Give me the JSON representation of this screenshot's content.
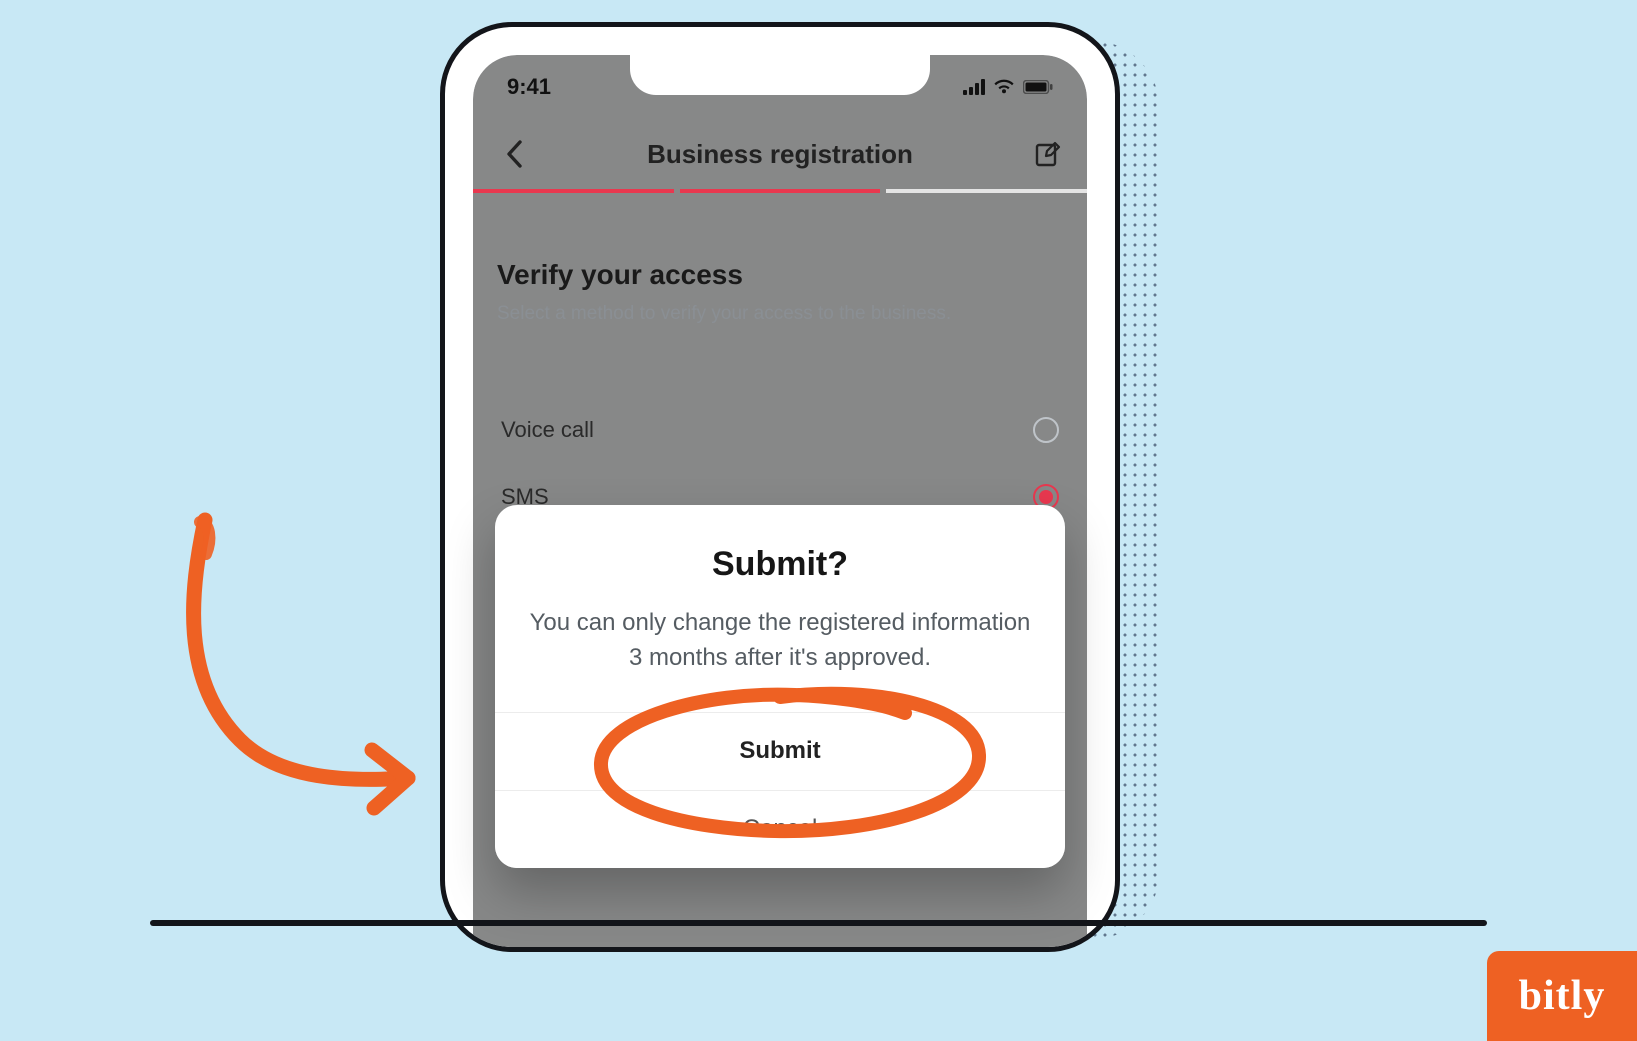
{
  "status_bar": {
    "time": "9:41"
  },
  "nav": {
    "title": "Business registration"
  },
  "page": {
    "heading": "Verify your access",
    "subheading": "Select a method to verify your access to the business."
  },
  "options": [
    {
      "label": "Voice call",
      "selected": false
    },
    {
      "label": "SMS",
      "selected": true
    }
  ],
  "modal": {
    "title": "Submit?",
    "message": "You can only change the registered information 3 months after it's approved.",
    "primary": "Submit",
    "secondary": "Cancel"
  },
  "watermark": {
    "brand": "bitly"
  }
}
